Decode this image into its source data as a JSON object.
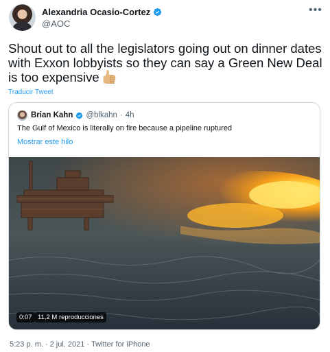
{
  "author": {
    "name": "Alexandria Ocasio-Cortez",
    "handle": "@AOC",
    "verified": true
  },
  "tweet": {
    "text": "Shout out to all the legislators going out on dinner dates with Exxon lobbyists so they can say a Green New Deal is too expensive",
    "emoji": "thumbs-up-icon",
    "translate_label": "Traducir Tweet"
  },
  "quoted": {
    "name": "Brian Kahn",
    "handle": "@blkahn",
    "separator": "·",
    "time": "4h",
    "text": "The Gulf of Mexico is literally on fire because a pipeline ruptured",
    "show_thread_label": "Mostrar este hilo",
    "video": {
      "duration": "0:07",
      "views": "11,2 M reproducciones"
    }
  },
  "footer": {
    "time": "5:23 p. m.",
    "separator1": "·",
    "date": "2 jul. 2021",
    "separator2": "·",
    "source": "Twitter for iPhone"
  },
  "colors": {
    "accent": "#1d9bf0",
    "secondary_text": "#536471",
    "border": "#cfd9de"
  }
}
